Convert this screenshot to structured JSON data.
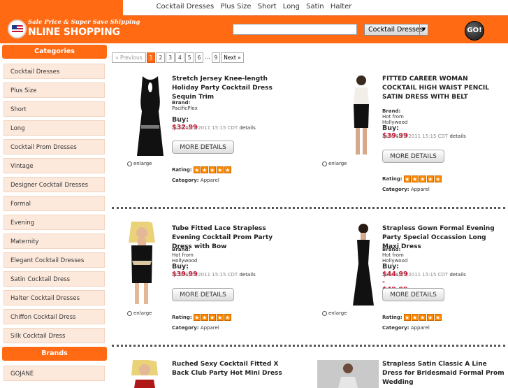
{
  "topnav": [
    "Cocktail Dresses",
    "Plus Size",
    "Short",
    "Long",
    "Satin",
    "Halter"
  ],
  "logo": {
    "tagline": "Sale Price & Super Save Shipping",
    "main": "NLINE SHOPPING"
  },
  "search": {
    "value": "",
    "category": "Cocktail Dresses",
    "go_label": "GO!"
  },
  "sidebar": {
    "categories_header": "Categories",
    "categories": [
      "Cocktail Dresses",
      "Plus Size",
      "Short",
      "Long",
      "Cocktail Prom Dresses",
      "Vintage",
      "Designer Cocktail Dresses",
      "Formal",
      "Evening",
      "Maternity",
      "Elegant Cocktail Dresses",
      "Satin Cocktail Dress",
      "Halter Cocktail Dresses",
      "Chiffon Cocktail Dress",
      "Silk Cocktail Dress"
    ],
    "brands_header": "Brands",
    "brands": [
      "GOJANE"
    ]
  },
  "pager": {
    "prev": "« Previous",
    "pages": [
      "1",
      "2",
      "3",
      "4",
      "5",
      "6"
    ],
    "dots": "...",
    "last": "9",
    "next": "Next »",
    "current": "1"
  },
  "labels": {
    "brand": "Brand:",
    "buy": "Buy:",
    "as_of": "as of 6/15/2011 15:15 CDT",
    "details": "details",
    "more": "MORE DETAILS",
    "rating": "Rating:",
    "category": "Category:",
    "enlarge": "enlarge"
  },
  "products": [
    {
      "title": "Stretch Jersey Knee-length Holiday Party Cocktail Dress Sequin Trim",
      "brand": "PacificPlex",
      "price": "$32.99",
      "category": "Apparel",
      "rating": 5,
      "dress_color": "#111111"
    },
    {
      "title": "FITTED CAREER WOMAN COCKTAIL HIGH WAIST PENCIL SATIN DRESS WITH BELT",
      "brand": "Hot from Hollywood",
      "price": "$39.99",
      "category": "Apparel",
      "rating": 5,
      "dress_color": "#111111"
    },
    {
      "title": "Tube Fitted Lace Strapless Evening Cocktail Prom Party Dress with Bow",
      "brand": "Hot from Hollywood",
      "price": "$39.99",
      "category": "Apparel",
      "rating": 5,
      "dress_color": "#111111"
    },
    {
      "title": "Strapless Gown Formal Evening Party Special Occassion Long Maxi Dress",
      "brand": "Hot from Hollywood",
      "price": "$44.99 - $49.99",
      "category": "Apparel",
      "rating": 5,
      "dress_color": "#111111"
    },
    {
      "title": "Ruched Sexy Cocktail Fitted X Back Club Party Hot Mini Dress",
      "brand": "",
      "price": "",
      "category": "",
      "rating": 0,
      "dress_color": "#b01818"
    },
    {
      "title": "Strapless Satin Classic A Line Dress for Bridesmaid Formal Prom Wedding",
      "brand": "",
      "price": "",
      "category": "",
      "rating": 0,
      "dress_color": "#d9d9d9"
    }
  ],
  "colors": {
    "accent": "#ff6a13",
    "price": "#c8102e",
    "sidebar_item_bg": "#fde9dc"
  }
}
